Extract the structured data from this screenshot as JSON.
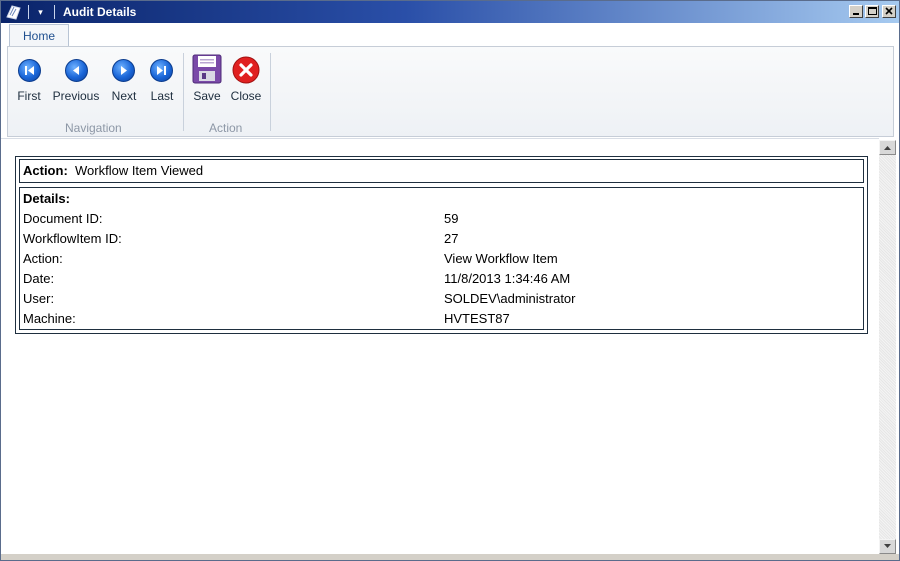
{
  "window": {
    "title": "Audit Details"
  },
  "ribbon": {
    "tabs": [
      {
        "label": "Home"
      }
    ],
    "navigation": {
      "group_label": "Navigation",
      "buttons": [
        {
          "label": "First",
          "icon": "first-icon"
        },
        {
          "label": "Previous",
          "icon": "previous-icon"
        },
        {
          "label": "Next",
          "icon": "next-icon"
        },
        {
          "label": "Last",
          "icon": "last-icon"
        }
      ]
    },
    "action": {
      "group_label": "Action",
      "buttons": [
        {
          "label": "Save",
          "icon": "save-icon"
        },
        {
          "label": "Close",
          "icon": "close-icon"
        }
      ]
    }
  },
  "audit": {
    "action_label": "Action:",
    "action_value": "Workflow Item Viewed",
    "details_heading": "Details:",
    "fields": [
      {
        "label": "Document ID:",
        "value": "59"
      },
      {
        "label": "WorkflowItem ID:",
        "value": "27"
      },
      {
        "label": "Action:",
        "value": "View Workflow Item"
      },
      {
        "label": "Date:",
        "value": "11/8/2013 1:34:46 AM"
      },
      {
        "label": "User:",
        "value": "SOLDEV\\administrator"
      },
      {
        "label": "Machine:",
        "value": "HVTEST87"
      }
    ]
  },
  "colors": {
    "titlebar_start": "#0a246a",
    "titlebar_end": "#a6caf0",
    "nav_button_blue": "#1a66d8",
    "close_red": "#e02020",
    "save_purple": "#7a4aa8"
  }
}
